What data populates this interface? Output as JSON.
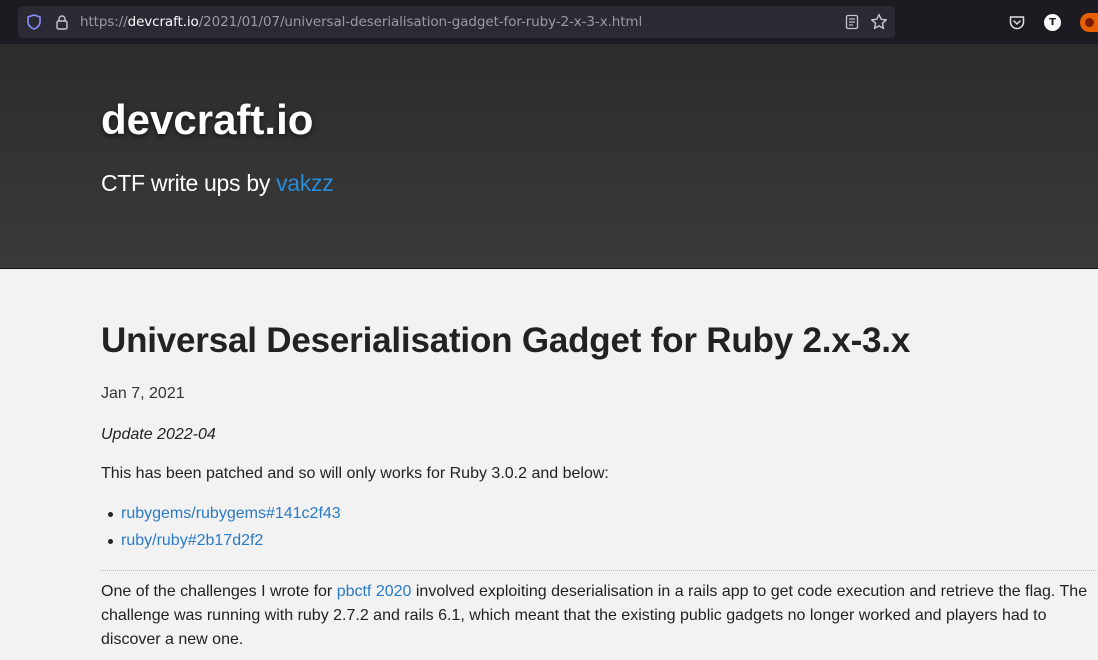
{
  "browser": {
    "url_prefix": "https://",
    "url_host": "devcraft.io",
    "url_path": "/2021/01/07/universal-deserialisation-gadget-for-ruby-2-x-3-x.html",
    "account_initial": "T"
  },
  "header": {
    "site_title": "devcraft.io",
    "tagline_text": "CTF write ups by ",
    "tagline_link": "vakzz"
  },
  "post": {
    "title": "Universal Deserialisation Gadget for Ruby 2.x-3.x",
    "date": "Jan 7, 2021",
    "update": "Update 2022-04",
    "patched_text": "This has been patched and so will only works for Ruby 3.0.2 and below:",
    "refs": [
      {
        "label": "rubygems/rubygems#141c2f43"
      },
      {
        "label": "ruby/ruby#2b17d2f2"
      }
    ],
    "intro_before": "One of the challenges I wrote for ",
    "intro_link": "pbctf 2020",
    "intro_after": " involved exploiting deserialisation in a rails app to get code execution and retrieve the flag. The challenge was running with ruby 2.7.2 and rails 6.1, which meant that the existing public gadgets no longer worked and players had to discover a new one."
  },
  "colors": {
    "link": "#2a7ac6",
    "header_bg": "#333333",
    "page_bg": "#f2f2f2"
  }
}
